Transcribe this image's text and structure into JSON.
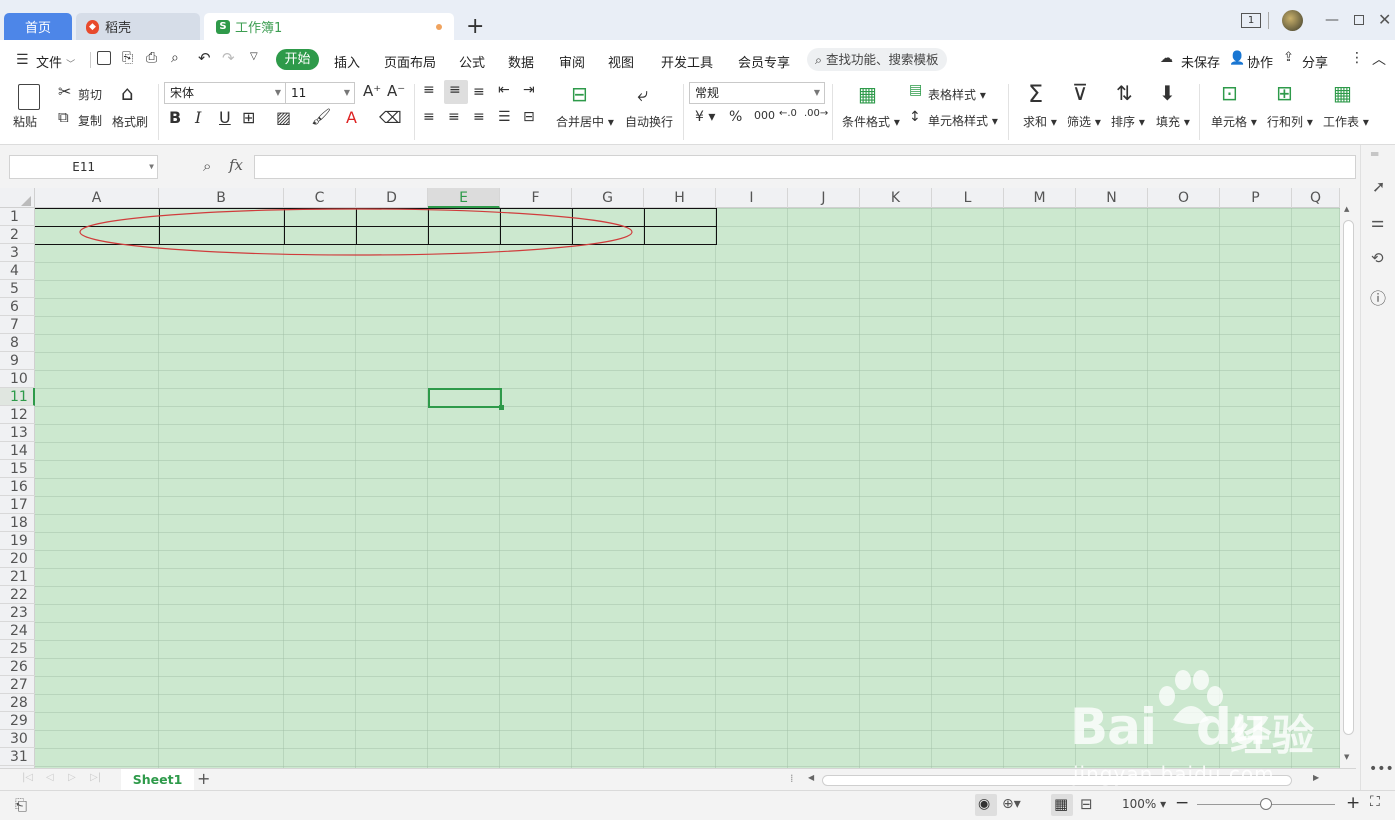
{
  "tabs": {
    "home": "首页",
    "daoke": "稻壳",
    "workbook": "工作簿1"
  },
  "menu": {
    "file": "文件",
    "items": [
      "开始",
      "插入",
      "页面布局",
      "公式",
      "数据",
      "审阅",
      "视图",
      "开发工具",
      "会员专享"
    ],
    "search": "查找功能、搜索模板",
    "unsaved": "未保存",
    "collab": "协作",
    "share": "分享"
  },
  "ribbon": {
    "paste": "粘贴",
    "cut": "剪切",
    "copy": "复制",
    "format_painter": "格式刷",
    "font_name": "宋体",
    "font_size": "11",
    "merge_center": "合并居中",
    "wrap_text": "自动换行",
    "number_format": "常规",
    "conditional_format": "条件格式",
    "table_style": "表格样式",
    "cell_style": "单元格样式",
    "sum": "求和",
    "filter": "筛选",
    "sort": "排序",
    "fill": "填充",
    "cell": "单元格",
    "row_col": "行和列",
    "worksheet": "工作表"
  },
  "formula_bar": {
    "name_box": "E11",
    "fx": "fx",
    "value": ""
  },
  "grid": {
    "columns": [
      "A",
      "B",
      "C",
      "D",
      "E",
      "F",
      "G",
      "H",
      "I",
      "J",
      "K",
      "L",
      "M",
      "N",
      "O",
      "P",
      "Q"
    ],
    "rows": [
      "1",
      "2",
      "3",
      "4",
      "5",
      "6",
      "7",
      "8",
      "9",
      "10",
      "11",
      "12",
      "13",
      "14",
      "15",
      "16",
      "17",
      "18",
      "19",
      "20",
      "21",
      "22",
      "23",
      "24",
      "25",
      "26",
      "27",
      "28",
      "29",
      "30",
      "31"
    ],
    "active_column": "E",
    "active_row": "11"
  },
  "sheets": {
    "active": "Sheet1"
  },
  "status": {
    "zoom": "100%"
  },
  "watermark": {
    "brand": "Bai",
    "brand_tail": "du",
    "cn": "经验",
    "url": "jingyan.baidu.com"
  },
  "colors": {
    "accent": "#2e9a4a",
    "sheet_bg": "#cce8cf",
    "ellipse": "#d03c3c",
    "home_tab": "#4d86e8"
  }
}
